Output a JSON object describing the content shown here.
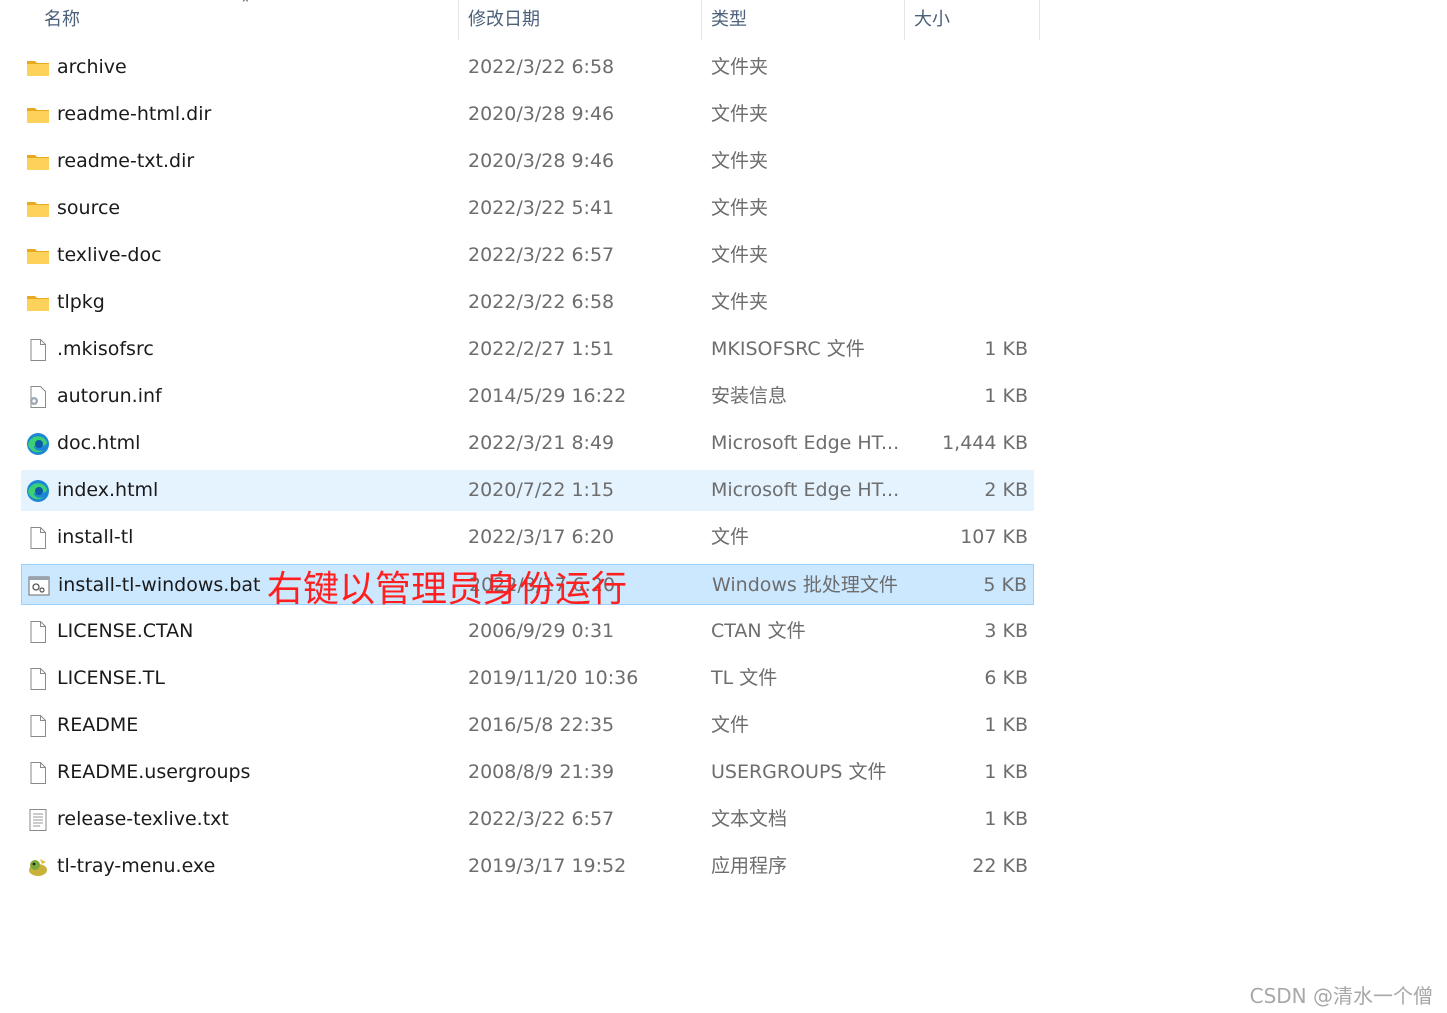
{
  "columns": {
    "name": "名称",
    "date": "修改日期",
    "type": "类型",
    "size": "大小"
  },
  "sort_indicator": "^",
  "files": [
    {
      "name": "archive",
      "date": "2022/3/22 6:58",
      "type": "文件夹",
      "size": "",
      "icon": "folder-icon",
      "state": "normal"
    },
    {
      "name": "readme-html.dir",
      "date": "2020/3/28 9:46",
      "type": "文件夹",
      "size": "",
      "icon": "folder-icon",
      "state": "normal"
    },
    {
      "name": "readme-txt.dir",
      "date": "2020/3/28 9:46",
      "type": "文件夹",
      "size": "",
      "icon": "folder-icon",
      "state": "normal"
    },
    {
      "name": "source",
      "date": "2022/3/22 5:41",
      "type": "文件夹",
      "size": "",
      "icon": "folder-icon",
      "state": "normal"
    },
    {
      "name": "texlive-doc",
      "date": "2022/3/22 6:57",
      "type": "文件夹",
      "size": "",
      "icon": "folder-icon",
      "state": "normal"
    },
    {
      "name": "tlpkg",
      "date": "2022/3/22 6:58",
      "type": "文件夹",
      "size": "",
      "icon": "folder-icon",
      "state": "normal"
    },
    {
      "name": ".mkisofsrc",
      "date": "2022/2/27 1:51",
      "type": "MKISOFSRC 文件",
      "size": "1 KB",
      "icon": "file-icon",
      "state": "normal"
    },
    {
      "name": "autorun.inf",
      "date": "2014/5/29 16:22",
      "type": "安装信息",
      "size": "1 KB",
      "icon": "settings-file-icon",
      "state": "normal"
    },
    {
      "name": "doc.html",
      "date": "2022/3/21 8:49",
      "type": "Microsoft Edge HT...",
      "size": "1,444 KB",
      "icon": "edge-icon",
      "state": "normal"
    },
    {
      "name": "index.html",
      "date": "2020/7/22 1:15",
      "type": "Microsoft Edge HT...",
      "size": "2 KB",
      "icon": "edge-icon",
      "state": "hover"
    },
    {
      "name": "install-tl",
      "date": "2022/3/17 6:20",
      "type": "文件",
      "size": "107 KB",
      "icon": "file-icon",
      "state": "normal"
    },
    {
      "name": "install-tl-windows.bat",
      "date": "2022/3/17 6:20",
      "type": "Windows 批处理文件",
      "size": "5 KB",
      "icon": "batch-file-icon",
      "state": "selected"
    },
    {
      "name": "LICENSE.CTAN",
      "date": "2006/9/29 0:31",
      "type": "CTAN 文件",
      "size": "3 KB",
      "icon": "file-icon",
      "state": "normal"
    },
    {
      "name": "LICENSE.TL",
      "date": "2019/11/20 10:36",
      "type": "TL 文件",
      "size": "6 KB",
      "icon": "file-icon",
      "state": "normal"
    },
    {
      "name": "README",
      "date": "2016/5/8 22:35",
      "type": "文件",
      "size": "1 KB",
      "icon": "file-icon",
      "state": "normal"
    },
    {
      "name": "README.usergroups",
      "date": "2008/8/9 21:39",
      "type": "USERGROUPS 文件",
      "size": "1 KB",
      "icon": "file-icon",
      "state": "normal"
    },
    {
      "name": "release-texlive.txt",
      "date": "2022/3/22 6:57",
      "type": "文本文档",
      "size": "1 KB",
      "icon": "text-file-icon",
      "state": "normal"
    },
    {
      "name": "tl-tray-menu.exe",
      "date": "2019/3/17 19:52",
      "type": "应用程序",
      "size": "22 KB",
      "icon": "app-icon",
      "state": "normal"
    }
  ],
  "annotation": "右键以管理员身份运行",
  "watermark": "CSDN @清水一个僧",
  "colors": {
    "selected_bg": "#cce8ff",
    "selected_border": "#99d1ff",
    "hover_bg": "#e5f3ff",
    "folder": "#f8c843",
    "annotation": "#ff1f1f"
  }
}
